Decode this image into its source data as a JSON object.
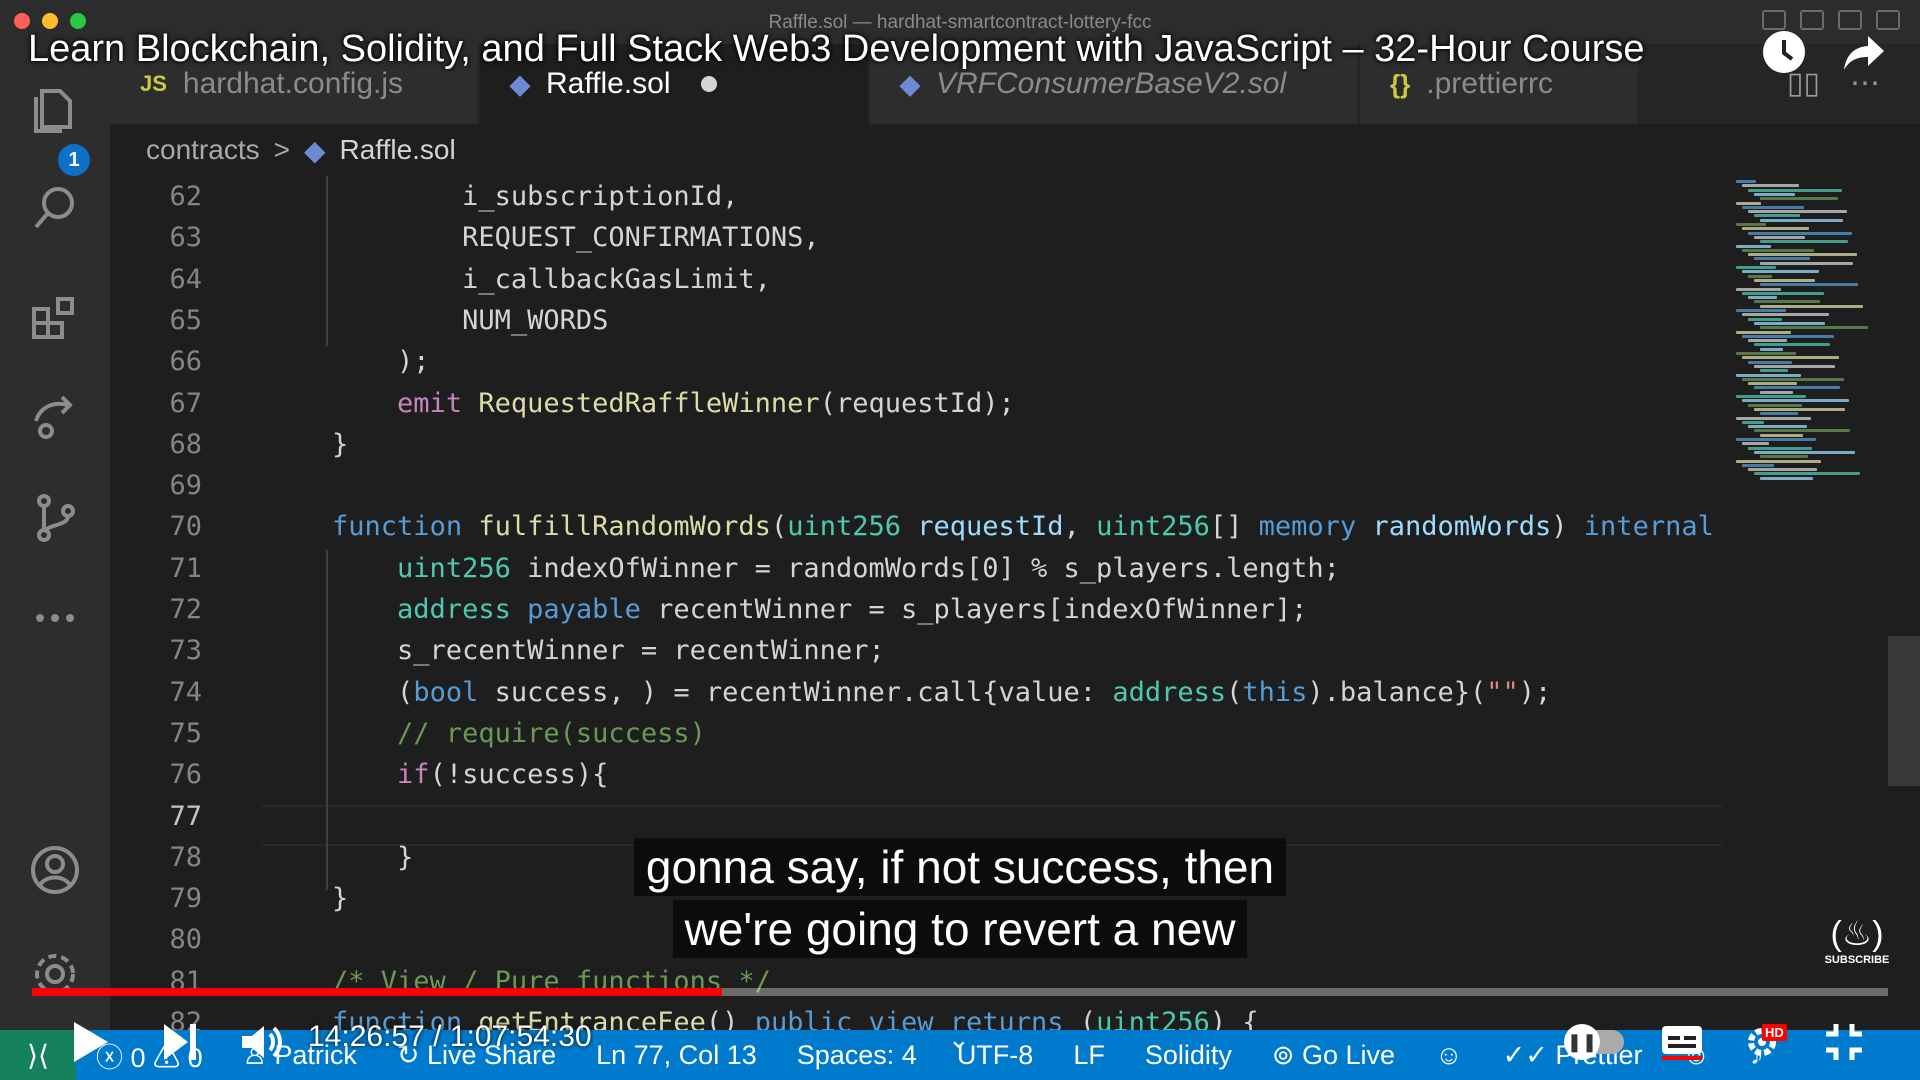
{
  "window": {
    "title": "Raffle.sol — hardhat-smartcontract-lottery-fcc"
  },
  "video": {
    "title": "Learn Blockchain, Solidity, and Full Stack Web3 Development with JavaScript – 32-Hour Course",
    "timecode": "14:26:57 / 1:07:54:30",
    "progress": 0.372,
    "caption_lines": [
      "gonna say, if not success, then",
      "we're going to revert a new"
    ],
    "subscribe_label": "SUBSCRIBE",
    "quality_badge": "HD",
    "icons": [
      "watch-later-icon",
      "share-icon",
      "play-icon",
      "next-icon",
      "volume-icon",
      "autoplay-toggle",
      "captions-icon",
      "settings-icon",
      "fullscreen-exit-icon"
    ]
  },
  "activity_bar": {
    "explorer_badge": "1",
    "icons": [
      "files-icon",
      "search-icon",
      "extensions-icon",
      "remote-explorer-icon",
      "source-control-icon",
      "more-icon",
      "account-icon",
      "settings-gear-icon"
    ]
  },
  "tabs": [
    {
      "icon": "JS",
      "label": "hardhat.config.js",
      "active": false
    },
    {
      "icon": "◆",
      "label": "Raffle.sol",
      "active": true,
      "modified": true
    },
    {
      "icon": "◆",
      "label": "VRFConsumerBaseV2.sol",
      "active": false
    },
    {
      "icon": "{}",
      "label": ".prettierrc",
      "active": false
    }
  ],
  "breadcrumb": {
    "folder": "contracts",
    "separator": ">",
    "file": "Raffle.sol"
  },
  "editor": {
    "current_line": 77,
    "line_numbers": [
      "62",
      "63",
      "64",
      "65",
      "66",
      "67",
      "68",
      "69",
      "70",
      "71",
      "72",
      "73",
      "74",
      "75",
      "76",
      "77",
      "78",
      "79",
      "80",
      "81",
      "82"
    ],
    "lines": [
      [
        [
          "pl",
          "            i_subscriptionId,"
        ]
      ],
      [
        [
          "pl",
          "            REQUEST_CONFIRMATIONS,"
        ]
      ],
      [
        [
          "pl",
          "            i_callbackGasLimit,"
        ]
      ],
      [
        [
          "pl",
          "            NUM_WORDS"
        ]
      ],
      [
        [
          "pl",
          "        );"
        ]
      ],
      [
        [
          "pl",
          "        "
        ],
        [
          "cf",
          "emit "
        ],
        [
          "fn",
          "RequestedRaffleWinner"
        ],
        [
          "pl",
          "(requestId);"
        ]
      ],
      [
        [
          "pl",
          "    }"
        ]
      ],
      [
        [
          "pl",
          ""
        ]
      ],
      [
        [
          "pl",
          "    "
        ],
        [
          "kw",
          "function "
        ],
        [
          "fn",
          "fulfillRandomWords"
        ],
        [
          "pl",
          "("
        ],
        [
          "ty",
          "uint256 "
        ],
        [
          "pa",
          "requestId"
        ],
        [
          "pl",
          ", "
        ],
        [
          "ty",
          "uint256"
        ],
        [
          "pl",
          "[] "
        ],
        [
          "kw",
          "memory "
        ],
        [
          "pa",
          "randomWords"
        ],
        [
          "pl",
          ") "
        ],
        [
          "kw",
          "internal"
        ]
      ],
      [
        [
          "pl",
          "        "
        ],
        [
          "ty",
          "uint256 "
        ],
        [
          "pl",
          "indexOfWinner = randomWords[0] % s_players.length;"
        ]
      ],
      [
        [
          "pl",
          "        "
        ],
        [
          "ty",
          "address "
        ],
        [
          "kw",
          "payable "
        ],
        [
          "pl",
          "recentWinner = s_players[indexOfWinner];"
        ]
      ],
      [
        [
          "pl",
          "        s_recentWinner = recentWinner;"
        ]
      ],
      [
        [
          "pl",
          "        ("
        ],
        [
          "kw",
          "bool "
        ],
        [
          "pl",
          "success, ) = recentWinner.call{value: "
        ],
        [
          "ty",
          "address"
        ],
        [
          "pl",
          "("
        ],
        [
          "kw",
          "this"
        ],
        [
          "pl",
          ").balance}("
        ],
        [
          "st",
          "\"\""
        ],
        [
          "pl",
          ");"
        ]
      ],
      [
        [
          "cm",
          "        // require(success)"
        ]
      ],
      [
        [
          "pl",
          "        "
        ],
        [
          "cf",
          "if"
        ],
        [
          "pl",
          "(!success){"
        ]
      ],
      [
        [
          "pl",
          ""
        ]
      ],
      [
        [
          "pl",
          "        }"
        ]
      ],
      [
        [
          "pl",
          "    }"
        ]
      ],
      [
        [
          "pl",
          ""
        ]
      ],
      [
        [
          "cm",
          "    /* View / Pure functions */"
        ]
      ],
      [
        [
          "pl",
          "    "
        ],
        [
          "kw",
          "function "
        ],
        [
          "fn",
          "getEntranceFee"
        ],
        [
          "pl",
          "() "
        ],
        [
          "kw",
          "public view returns "
        ],
        [
          "pl",
          "("
        ],
        [
          "ty",
          "uint256"
        ],
        [
          "pl",
          ") {"
        ]
      ]
    ]
  },
  "statusbar": {
    "remote": "⟩⟨",
    "errors": "0",
    "warnings": "0",
    "user": "Patrick",
    "live_share": "Live Share",
    "position": "Ln 77, Col 13",
    "spaces": "Spaces: 4",
    "encoding": "UTF-8",
    "eol": "LF",
    "language": "Solidity",
    "go_live": "Go Live",
    "prettier": "Prettier"
  },
  "colors": {
    "statusbar": "#007acc",
    "progress": "#ff0000",
    "editor_bg": "#1e1e1e"
  }
}
